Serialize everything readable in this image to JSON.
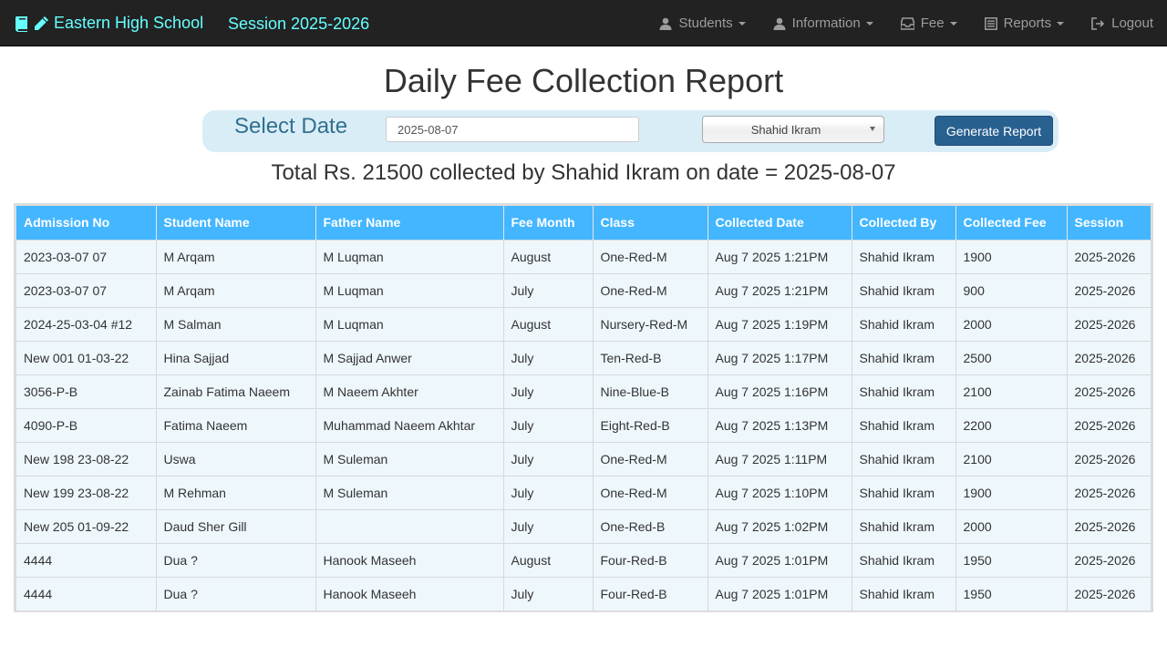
{
  "navbar": {
    "brand": "Eastern High School",
    "session": "Session 2025-2026",
    "menu": [
      {
        "label": "Students",
        "icon": "user-icon",
        "dropdown": true
      },
      {
        "label": "Information",
        "icon": "user-icon",
        "dropdown": true
      },
      {
        "label": "Fee",
        "icon": "inbox-icon",
        "dropdown": true
      },
      {
        "label": "Reports",
        "icon": "list-alt-icon",
        "dropdown": true
      },
      {
        "label": "Logout",
        "icon": "log-out-icon",
        "dropdown": false
      }
    ]
  },
  "page_title": "Daily Fee Collection Report",
  "form": {
    "select_label": "Select Date",
    "date_value": "2025-08-07",
    "collector_selected": "Shahid Ikram",
    "generate_label": "Generate Report"
  },
  "summary": "Total Rs. 21500 collected by Shahid Ikram on date = 2025-08-07",
  "colors": {
    "navbar_bg": "#222222",
    "brand": "#66ffff",
    "table_header": "#44b6ff",
    "form_bar": "#d9edf7",
    "button": "#286090"
  },
  "table": {
    "columns": [
      "Admission No",
      "Student Name",
      "Father Name",
      "Fee Month",
      "Class",
      "Collected Date",
      "Collected By",
      "Collected Fee",
      "Session"
    ],
    "rows": [
      [
        "2023-03-07 07",
        "M Arqam",
        "M Luqman",
        "August",
        "One-Red-M",
        "Aug 7 2025 1:21PM",
        "Shahid Ikram",
        "1900",
        "2025-2026"
      ],
      [
        "2023-03-07 07",
        "M Arqam",
        "M Luqman",
        "July",
        "One-Red-M",
        "Aug 7 2025 1:21PM",
        "Shahid Ikram",
        "900",
        "2025-2026"
      ],
      [
        "2024-25-03-04 #12",
        "M Salman",
        "M Luqman",
        "August",
        "Nursery-Red-M",
        "Aug 7 2025 1:19PM",
        "Shahid Ikram",
        "2000",
        "2025-2026"
      ],
      [
        "New 001 01-03-22",
        "Hina Sajjad",
        "M Sajjad Anwer",
        "July",
        "Ten-Red-B",
        "Aug 7 2025 1:17PM",
        "Shahid Ikram",
        "2500",
        "2025-2026"
      ],
      [
        "3056-P-B",
        "Zainab Fatima Naeem",
        "M Naeem Akhter",
        "July",
        "Nine-Blue-B",
        "Aug 7 2025 1:16PM",
        "Shahid Ikram",
        "2100",
        "2025-2026"
      ],
      [
        "4090-P-B",
        "Fatima Naeem",
        "Muhammad Naeem Akhtar",
        "July",
        "Eight-Red-B",
        "Aug 7 2025 1:13PM",
        "Shahid Ikram",
        "2200",
        "2025-2026"
      ],
      [
        "New 198 23-08-22",
        "Uswa",
        "M Suleman",
        "July",
        "One-Red-M",
        "Aug 7 2025 1:11PM",
        "Shahid Ikram",
        "2100",
        "2025-2026"
      ],
      [
        "New 199 23-08-22",
        "M Rehman",
        "M Suleman",
        "July",
        "One-Red-M",
        "Aug 7 2025 1:10PM",
        "Shahid Ikram",
        "1900",
        "2025-2026"
      ],
      [
        "New 205 01-09-22",
        "Daud Sher Gill",
        "",
        "July",
        "One-Red-B",
        "Aug 7 2025 1:02PM",
        "Shahid Ikram",
        "2000",
        "2025-2026"
      ],
      [
        "4444",
        "Dua ?",
        "Hanook Maseeh",
        "August",
        "Four-Red-B",
        "Aug 7 2025 1:01PM",
        "Shahid Ikram",
        "1950",
        "2025-2026"
      ],
      [
        "4444",
        "Dua ?",
        "Hanook Maseeh",
        "July",
        "Four-Red-B",
        "Aug 7 2025 1:01PM",
        "Shahid Ikram",
        "1950",
        "2025-2026"
      ]
    ]
  }
}
